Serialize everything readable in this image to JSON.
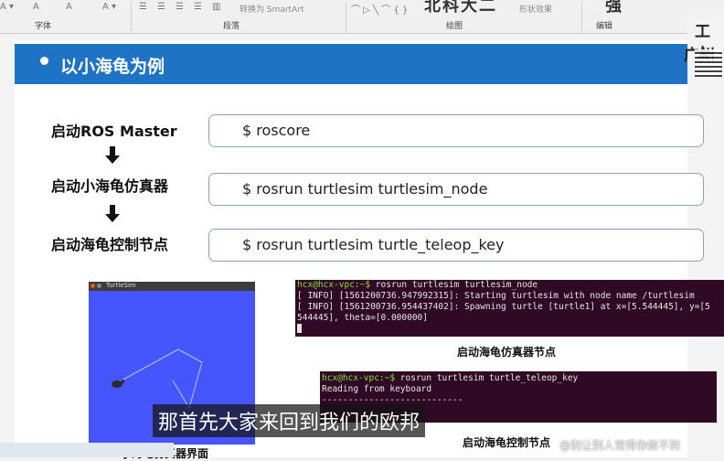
{
  "ribbon": {
    "group_font": "字体",
    "group_paragraph": "段落",
    "group_drawing": "绘图",
    "group_edit": "编辑",
    "convert_smartart": "转换为 SmartArt",
    "shape_effect": "形状效果",
    "overlay_text": "北科大二",
    "overlay_char": "强"
  },
  "side": {
    "line1": "工大",
    "line2": "广州"
  },
  "slide": {
    "title": "以小海龟为例",
    "steps": [
      {
        "label": "启动ROS Master",
        "command": "$ roscore"
      },
      {
        "label": "启动小海龟仿真器",
        "command": "$ rosrun turtlesim turtlesim_node"
      },
      {
        "label": "启动海龟控制节点",
        "command": "$ rosrun turtlesim turtle_teleop_key"
      }
    ],
    "turtlesim": {
      "window_title": "TurtleSim",
      "caption": "小海龟仿真器界面"
    },
    "terminal1": {
      "prompt": "hcx@hcx-vpc:~$",
      "command": " rosrun turtlesim turtlesim_node",
      "lines": [
        "[ INFO] [1561200736.947992315]: Starting turtlesim with node name /turtlesim",
        "[ INFO] [1561200736.954437402]: Spawning turtle [turtle1] at x=[5.544445], y=[5",
        "544445], theta=[0.000000]"
      ],
      "caption": "启动海龟仿真器节点"
    },
    "terminal2": {
      "prompt": "hcx@hcx-vpc:~$",
      "command": " rosrun turtlesim turtle_teleop_key",
      "lines": [
        "Reading from keyboard",
        "---------------------------"
      ],
      "caption": "启动海龟控制节点"
    }
  },
  "subtitle": "那首先大家来回到我们的欧邦",
  "watermark": "@别让别人觉得你做不到",
  "colors": {
    "title_bar": "#1f73c4",
    "terminal_bg": "#300a24",
    "turtlesim_bg": "#4556ff",
    "prompt": "#8ae234"
  }
}
